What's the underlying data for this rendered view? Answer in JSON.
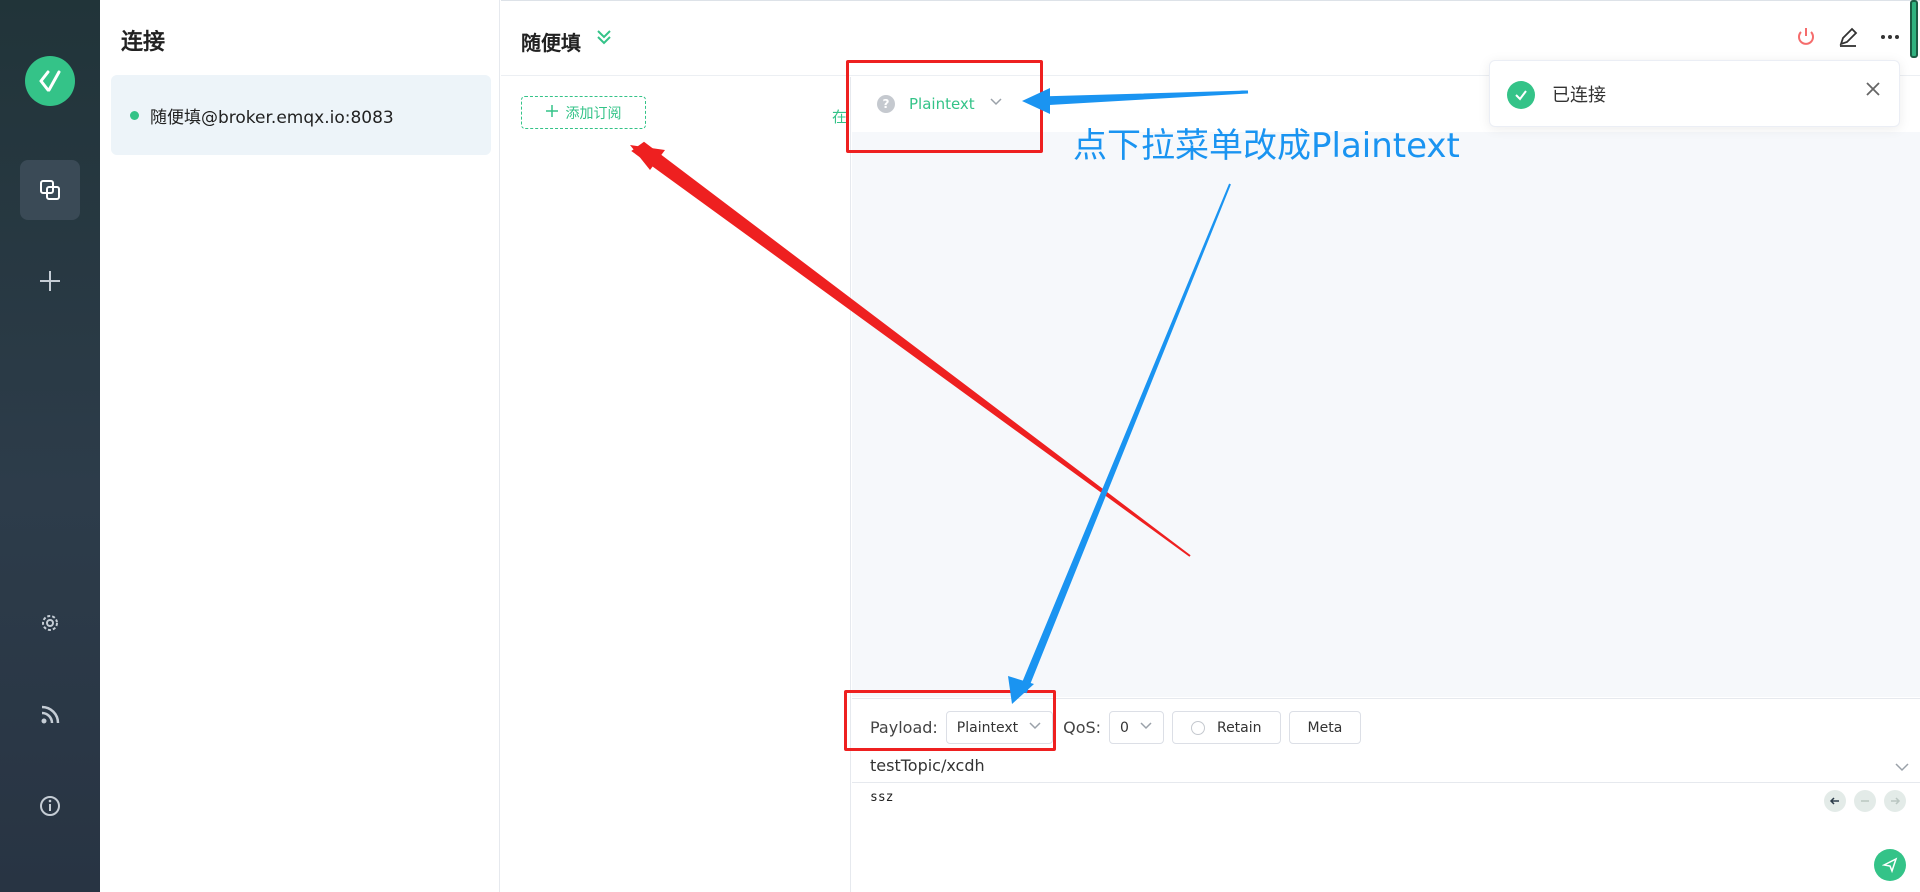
{
  "sidebar": {
    "logo_icon": "mqttx-logo-icon",
    "items": [
      {
        "icon": "connections-icon",
        "active": true
      },
      {
        "icon": "plus-icon"
      },
      {
        "icon": "gear-icon"
      },
      {
        "icon": "log-icon"
      },
      {
        "icon": "info-icon"
      }
    ]
  },
  "connections": {
    "title": "连接",
    "items": [
      {
        "name": "随便填@broker.emqx.io:8083",
        "status_color": "#34c388"
      }
    ]
  },
  "header": {
    "title": "随便填"
  },
  "subscriptions": {
    "add_label": "添加订阅",
    "cut_text": "在"
  },
  "messages": {
    "type_hint": "?",
    "type_value": "Plaintext"
  },
  "publish": {
    "payload_label": "Payload:",
    "payload_format": "Plaintext",
    "qos_label": "QoS:",
    "qos_value": "0",
    "retain_label": "Retain",
    "meta_label": "Meta",
    "topic": "testTopic/xcdh",
    "payload": "ssz"
  },
  "toast": {
    "message": "已连接"
  },
  "annotation": {
    "text": "点下拉菜单改成Plaintext",
    "red_color": "#ee2020",
    "blue_color": "#1a94f1"
  },
  "colors": {
    "accent": "#34c388",
    "danger": "#f56c6c"
  }
}
